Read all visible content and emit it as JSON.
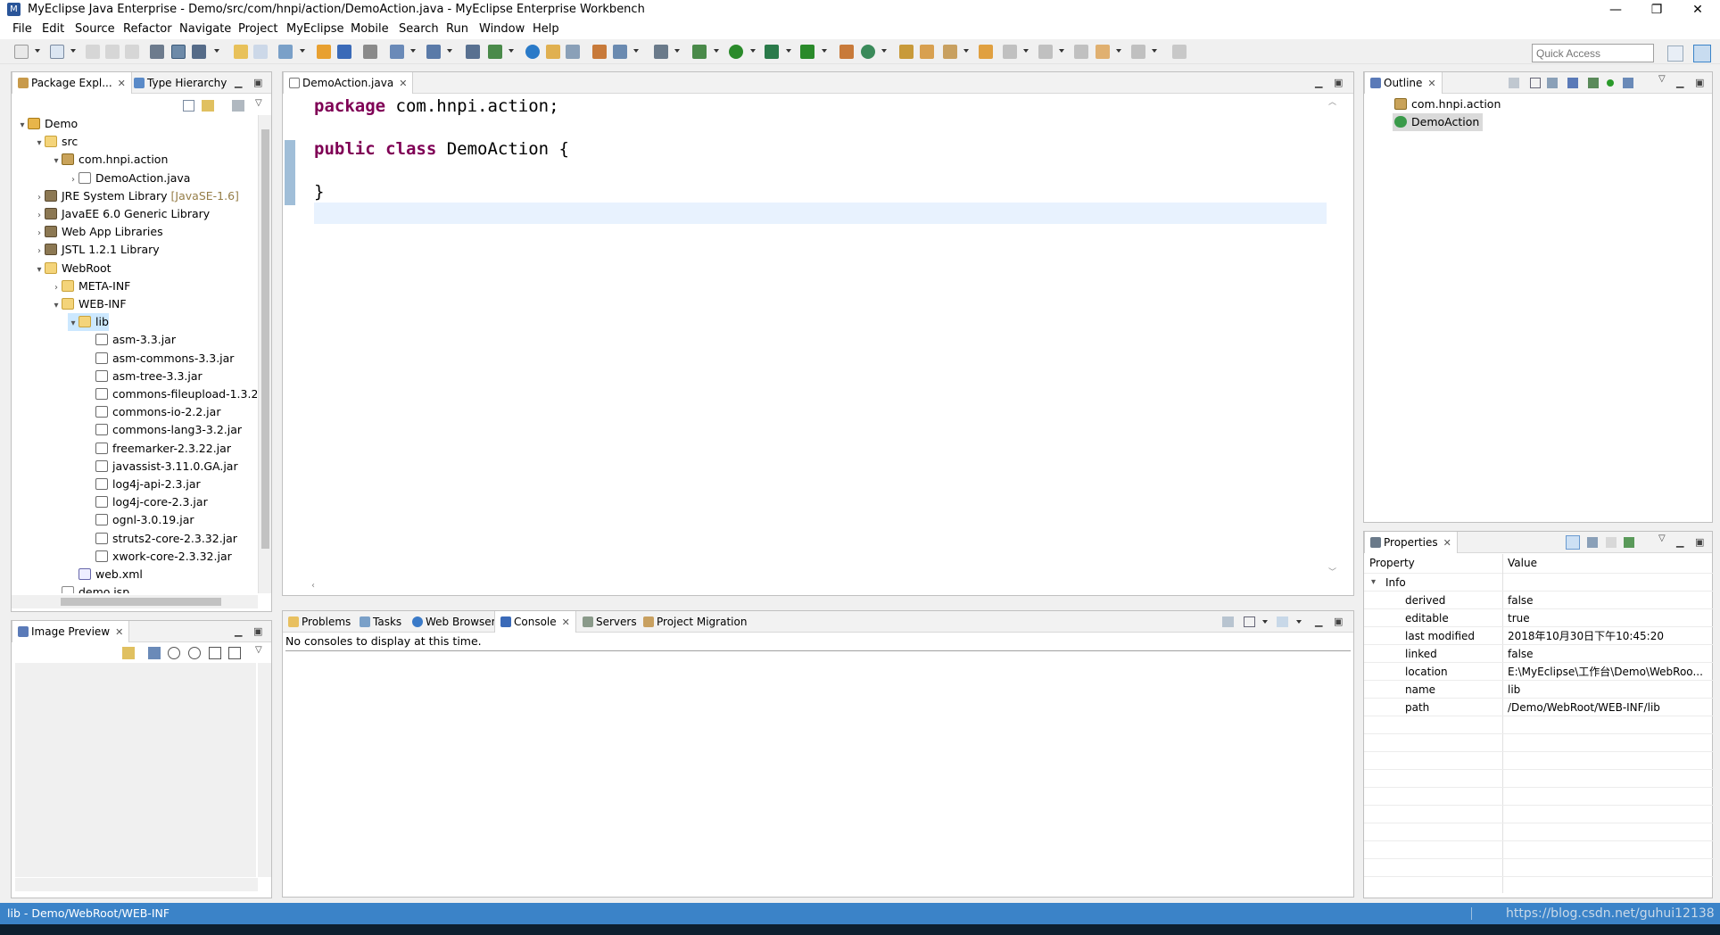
{
  "window": {
    "title": "MyEclipse Java Enterprise - Demo/src/com/hnpi/action/DemoAction.java - MyEclipse Enterprise Workbench",
    "minimize": "—",
    "restore": "❐",
    "close": "✕"
  },
  "menu": [
    "File",
    "Edit",
    "Source",
    "Refactor",
    "Navigate",
    "Project",
    "MyEclipse",
    "Mobile",
    "Search",
    "Run",
    "Window",
    "Help"
  ],
  "quick_access": {
    "placeholder": "Quick Access"
  },
  "package_explorer": {
    "tabs": [
      "Package Expl...",
      "Type Hierarchy"
    ],
    "tree": [
      {
        "label": "Demo",
        "icon": "project-icon",
        "toggle": "▾"
      },
      {
        "label": "src",
        "icon": "source-folder-icon",
        "toggle": "▾"
      },
      {
        "label": "com.hnpi.action",
        "icon": "package-icon",
        "toggle": "▾"
      },
      {
        "label": "DemoAction.java",
        "icon": "java-file-icon",
        "toggle": "›"
      },
      {
        "label": "JRE System Library",
        "suffix": "[JavaSE-1.6]",
        "icon": "library-icon",
        "toggle": "›"
      },
      {
        "label": "JavaEE 6.0 Generic Library",
        "icon": "library-icon",
        "toggle": "›"
      },
      {
        "label": "Web App Libraries",
        "icon": "library-icon",
        "toggle": "›"
      },
      {
        "label": "JSTL 1.2.1 Library",
        "icon": "library-icon",
        "toggle": "›"
      },
      {
        "label": "WebRoot",
        "icon": "folder-icon",
        "toggle": "▾"
      },
      {
        "label": "META-INF",
        "icon": "folder-icon",
        "toggle": "›"
      },
      {
        "label": "WEB-INF",
        "icon": "folder-icon",
        "toggle": "▾"
      },
      {
        "label": "lib",
        "icon": "folder-icon",
        "toggle": "▾"
      },
      {
        "label": "asm-3.3.jar",
        "icon": "jar-icon",
        "toggle": ""
      },
      {
        "label": "asm-commons-3.3.jar",
        "icon": "jar-icon",
        "toggle": ""
      },
      {
        "label": "asm-tree-3.3.jar",
        "icon": "jar-icon",
        "toggle": ""
      },
      {
        "label": "commons-fileupload-1.3.2",
        "icon": "jar-icon",
        "toggle": ""
      },
      {
        "label": "commons-io-2.2.jar",
        "icon": "jar-icon",
        "toggle": ""
      },
      {
        "label": "commons-lang3-3.2.jar",
        "icon": "jar-icon",
        "toggle": ""
      },
      {
        "label": "freemarker-2.3.22.jar",
        "icon": "jar-icon",
        "toggle": ""
      },
      {
        "label": "javassist-3.11.0.GA.jar",
        "icon": "jar-icon",
        "toggle": ""
      },
      {
        "label": "log4j-api-2.3.jar",
        "icon": "jar-icon",
        "toggle": ""
      },
      {
        "label": "log4j-core-2.3.jar",
        "icon": "jar-icon",
        "toggle": ""
      },
      {
        "label": "ognl-3.0.19.jar",
        "icon": "jar-icon",
        "toggle": ""
      },
      {
        "label": "struts2-core-2.3.32.jar",
        "icon": "jar-icon",
        "toggle": ""
      },
      {
        "label": "xwork-core-2.3.32.jar",
        "icon": "jar-icon",
        "toggle": ""
      },
      {
        "label": "web.xml",
        "icon": "xml-file-icon",
        "toggle": ""
      },
      {
        "label": "demo.jsp",
        "icon": "jsp-file-icon",
        "toggle": ""
      }
    ]
  },
  "image_preview": {
    "tab": "Image Preview"
  },
  "editor": {
    "tab": "DemoAction.java",
    "lines": [
      {
        "kw": "package",
        "rest": " com.hnpi.action;"
      },
      {
        "kw": "",
        "rest": ""
      },
      {
        "kw": "public class",
        "rest": " DemoAction {"
      },
      {
        "kw": "",
        "rest": ""
      },
      {
        "kw": "",
        "rest": "}"
      }
    ]
  },
  "bottom_panel": {
    "tabs": [
      "Problems",
      "Tasks",
      "Web Browser",
      "Console",
      "Servers",
      "Project Migration"
    ],
    "console_message": "No consoles to display at this time."
  },
  "outline": {
    "tab": "Outline",
    "items": [
      "com.hnpi.action",
      "DemoAction"
    ]
  },
  "properties": {
    "tab": "Properties",
    "headers": [
      "Property",
      "Value"
    ],
    "group": "Info",
    "rows": [
      {
        "k": "derived",
        "v": "false"
      },
      {
        "k": "editable",
        "v": "true"
      },
      {
        "k": "last modified",
        "v": "2018年10月30日下午10:45:20"
      },
      {
        "k": "linked",
        "v": "false"
      },
      {
        "k": "location",
        "v": "E:\\MyEclipse\\工作台\\Demo\\WebRoo..."
      },
      {
        "k": "name",
        "v": "lib"
      },
      {
        "k": "path",
        "v": "/Demo/WebRoot/WEB-INF/lib"
      }
    ]
  },
  "status": {
    "path": "lib - Demo/WebRoot/WEB-INF",
    "watermark": "https://blog.csdn.net/guhui12138"
  },
  "colors": {
    "keyword": "#7f0055",
    "status_bar": "#3b83c8",
    "selection": "#cce8ff"
  }
}
